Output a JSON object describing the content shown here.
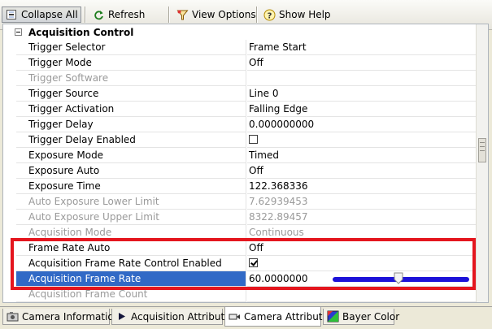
{
  "toolbar": {
    "collapse_all": "Collapse All",
    "refresh": "Refresh",
    "view_options": "View Options",
    "show_help": "Show Help"
  },
  "category": {
    "label": "Acquisition Control",
    "state": "expanded"
  },
  "rows": [
    {
      "name": "Trigger Selector",
      "value": "Frame Start",
      "enabled": true
    },
    {
      "name": "Trigger Mode",
      "value": "Off",
      "enabled": true
    },
    {
      "name": "Trigger Software",
      "value": "",
      "enabled": false
    },
    {
      "name": "Trigger Source",
      "value": "Line 0",
      "enabled": true
    },
    {
      "name": "Trigger Activation",
      "value": "Falling Edge",
      "enabled": true
    },
    {
      "name": "Trigger Delay",
      "value": "0.000000000",
      "enabled": true
    },
    {
      "name": "Trigger Delay Enabled",
      "value": "",
      "checked": false,
      "enabled": true
    },
    {
      "name": "Exposure Mode",
      "value": "Timed",
      "enabled": true
    },
    {
      "name": "Exposure Auto",
      "value": "Off",
      "enabled": true
    },
    {
      "name": "Exposure Time",
      "value": "122.368336",
      "enabled": true
    },
    {
      "name": "Auto Exposure Lower Limit",
      "value": "7.62939453",
      "enabled": false
    },
    {
      "name": "Auto Exposure Upper Limit",
      "value": "8322.89457",
      "enabled": false
    },
    {
      "name": "Acquisition Mode",
      "value": "Continuous",
      "enabled": false
    },
    {
      "name": "Frame Rate Auto",
      "value": "Off",
      "enabled": true
    },
    {
      "name": "Acquisition Frame Rate Control Enabled",
      "value": "",
      "checked": true,
      "enabled": true
    },
    {
      "name": "Acquisition Frame Rate",
      "value": "60.0000000",
      "enabled": true,
      "selected": true,
      "slider_fraction": 0.48
    },
    {
      "name": "Acquisition Frame Count",
      "value": "",
      "enabled": false
    }
  ],
  "tabs": [
    {
      "label": "Camera Information",
      "icon": "camera-icon"
    },
    {
      "label": "Acquisition Attributes",
      "icon": "play-arrow-icon"
    },
    {
      "label": "Camera Attributes",
      "icon": "camera-link-icon",
      "active": true
    },
    {
      "label": "Bayer Color",
      "icon": "bayer-color-icon"
    }
  ],
  "colors": {
    "selection": "#3169c6",
    "slider": "#1c12d8",
    "highlight": "#e4161e"
  }
}
